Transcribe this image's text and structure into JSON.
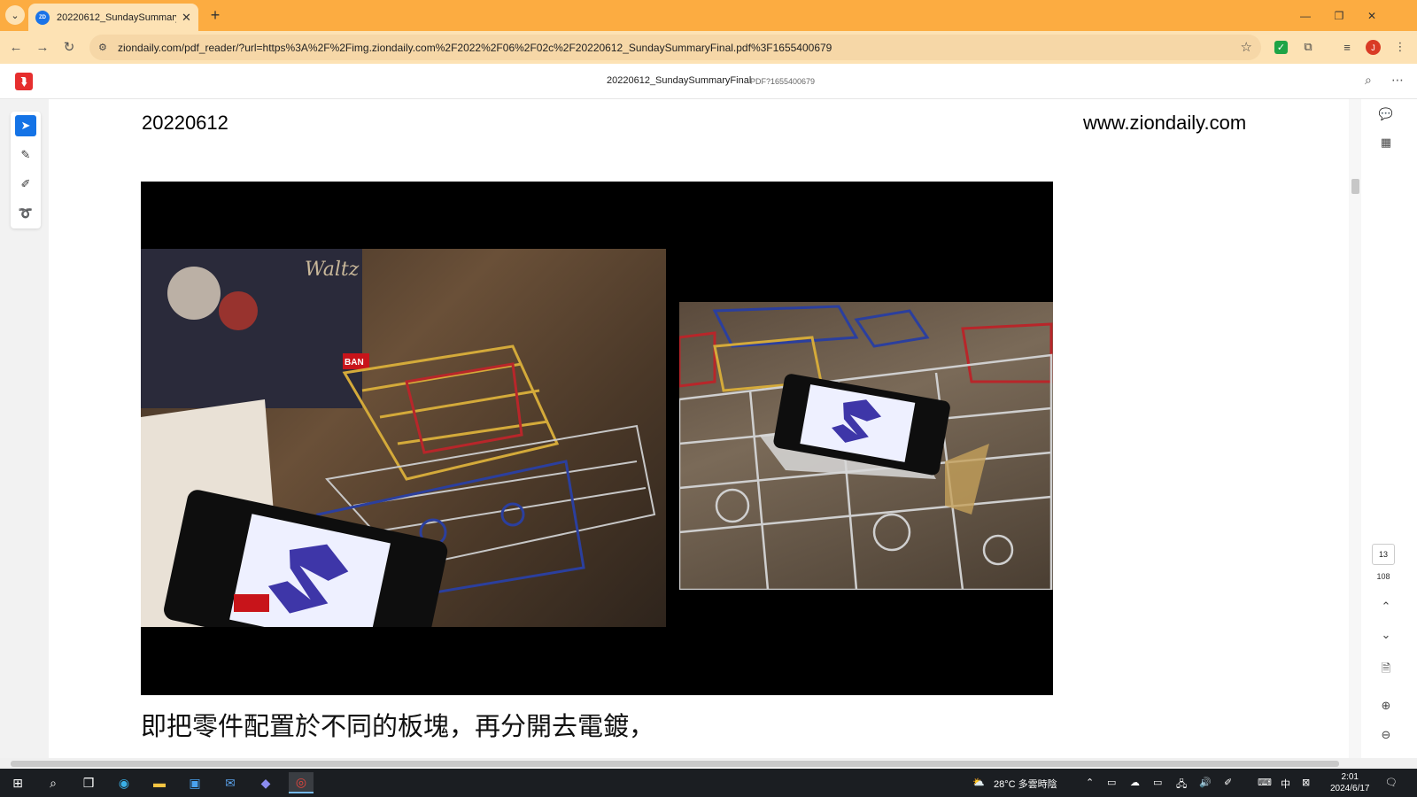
{
  "browser": {
    "tab_title": "20220612_SundaySummaryF",
    "tab_favicon_text": "ZD",
    "url": "ziondaily.com/pdf_reader/?url=https%3A%2F%2Fimg.ziondaily.com%2F2022%2F06%2F02c%2F20220612_SundaySummaryFinal.pdf%3F1655400679",
    "profile_initial": "J",
    "accent": "#fcac41"
  },
  "pdf_viewer": {
    "doc_title": "20220612_SundaySummaryFinal",
    "doc_subtitle": "PDF?1655400679",
    "current_page": "13",
    "total_pages": "108",
    "logo_glyph": "⮯"
  },
  "page": {
    "date": "20220612",
    "site": "www.ziondaily.com",
    "caption": "即把零件配置於不同的板塊，再分開去電鍍，",
    "photo_box_text": "BAN",
    "photo_box_text2": "BAN",
    "title_card": "Waltz"
  },
  "taskbar": {
    "weather": "28°C 多雲時陰",
    "ime": "中",
    "time": "2:01",
    "date": "2024/6/17"
  }
}
